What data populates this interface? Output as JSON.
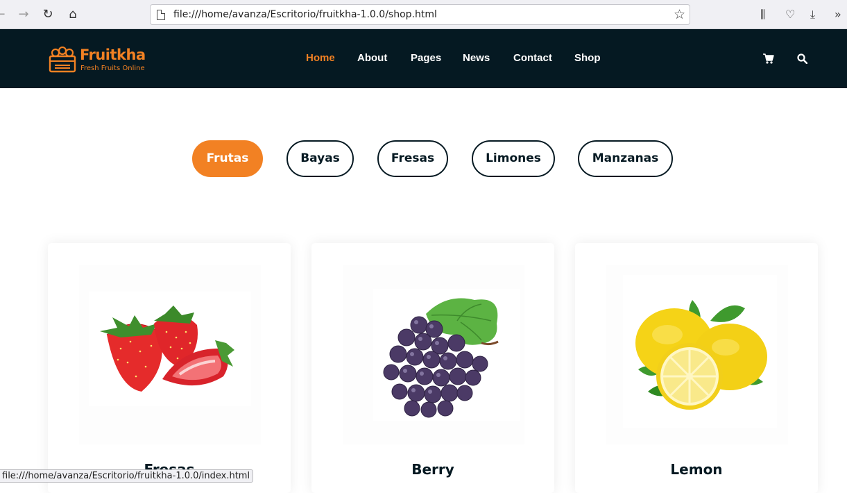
{
  "browser": {
    "url": "file:///home/avanza/Escritorio/fruitkha-1.0.0/shop.html",
    "status_url": "file:///home/avanza/Escritorio/fruitkha-1.0.0/index.html",
    "icons": [
      "back-icon",
      "forward-icon",
      "reload-icon",
      "home-icon",
      "page-icon",
      "bookmark-star-icon",
      "library-icon",
      "pocket-icon",
      "download-icon",
      "overflow-icon"
    ]
  },
  "site": {
    "logo_name": "Fruitkha",
    "logo_tagline": "Fresh Fruits Online",
    "menu": [
      {
        "label": "Home",
        "active": true
      },
      {
        "label": "About",
        "active": false
      },
      {
        "label": "Pages",
        "active": false
      },
      {
        "label": "News",
        "active": false
      },
      {
        "label": "Contact",
        "active": false
      },
      {
        "label": "Shop",
        "active": false
      }
    ],
    "header_icons": [
      "cart-icon",
      "search-icon"
    ]
  },
  "filters": [
    {
      "label": "Frutas",
      "active": true
    },
    {
      "label": "Bayas",
      "active": false
    },
    {
      "label": "Fresas",
      "active": false
    },
    {
      "label": "Limones",
      "active": false
    },
    {
      "label": "Manzanas",
      "active": false
    }
  ],
  "products": [
    {
      "name": "Fresas",
      "image": "strawberry-image"
    },
    {
      "name": "Berry",
      "image": "grapes-image"
    },
    {
      "name": "Lemon",
      "image": "lemon-image"
    }
  ],
  "colors": {
    "accent": "#F28123",
    "header_bg": "#051922",
    "text_dark": "#051922"
  }
}
